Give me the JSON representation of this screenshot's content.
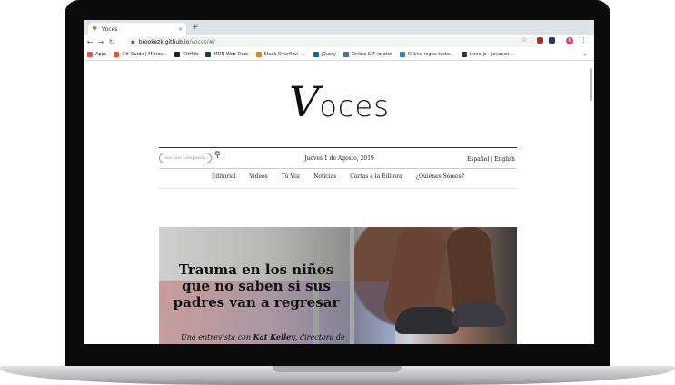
{
  "browser": {
    "tab_title": "Voces",
    "tab_close": "×",
    "new_tab": "+",
    "url_host": "brookezk.github.io",
    "url_path": "/Voces/#/",
    "avatar_letter": "K",
    "bookmarks": [
      {
        "label": "Apps",
        "color": "#e0564b"
      },
      {
        "label": "C# Guide | Micros...",
        "color": "#f25022"
      },
      {
        "label": "GitHub",
        "color": "#222222"
      },
      {
        "label": "MDN Web Docs",
        "color": "#1c3a63"
      },
      {
        "label": "Stack Overflow -...",
        "color": "#f48024"
      },
      {
        "label": "jQuery",
        "color": "#0769ad"
      },
      {
        "label": "Online GIF rotator",
        "color": "#4a6da7"
      },
      {
        "label": "Online regex teste...",
        "color": "#2e7bcf"
      },
      {
        "label": "three.js – Javascri...",
        "color": "#333333"
      }
    ],
    "bookmarks_more": "»"
  },
  "site": {
    "logo_v": "V",
    "logo_rest": "oces",
    "search_placeholder": "haz una búsqueda...",
    "date": "Jueves 1 de Agosto, 2019",
    "lang": "Español | English",
    "nav": [
      "Editorial",
      "Videos",
      "Tú Voz",
      "Noticias",
      "Cartas a la Editora",
      "¿Quiénes Sómos?"
    ]
  },
  "hero": {
    "title": "Trauma en los niños que no saben si sus padres van a regresar",
    "sub_prefix": "Una entrevista con ",
    "sub_name": "Kat Kelley",
    "sub_suffix": ", directora de"
  }
}
